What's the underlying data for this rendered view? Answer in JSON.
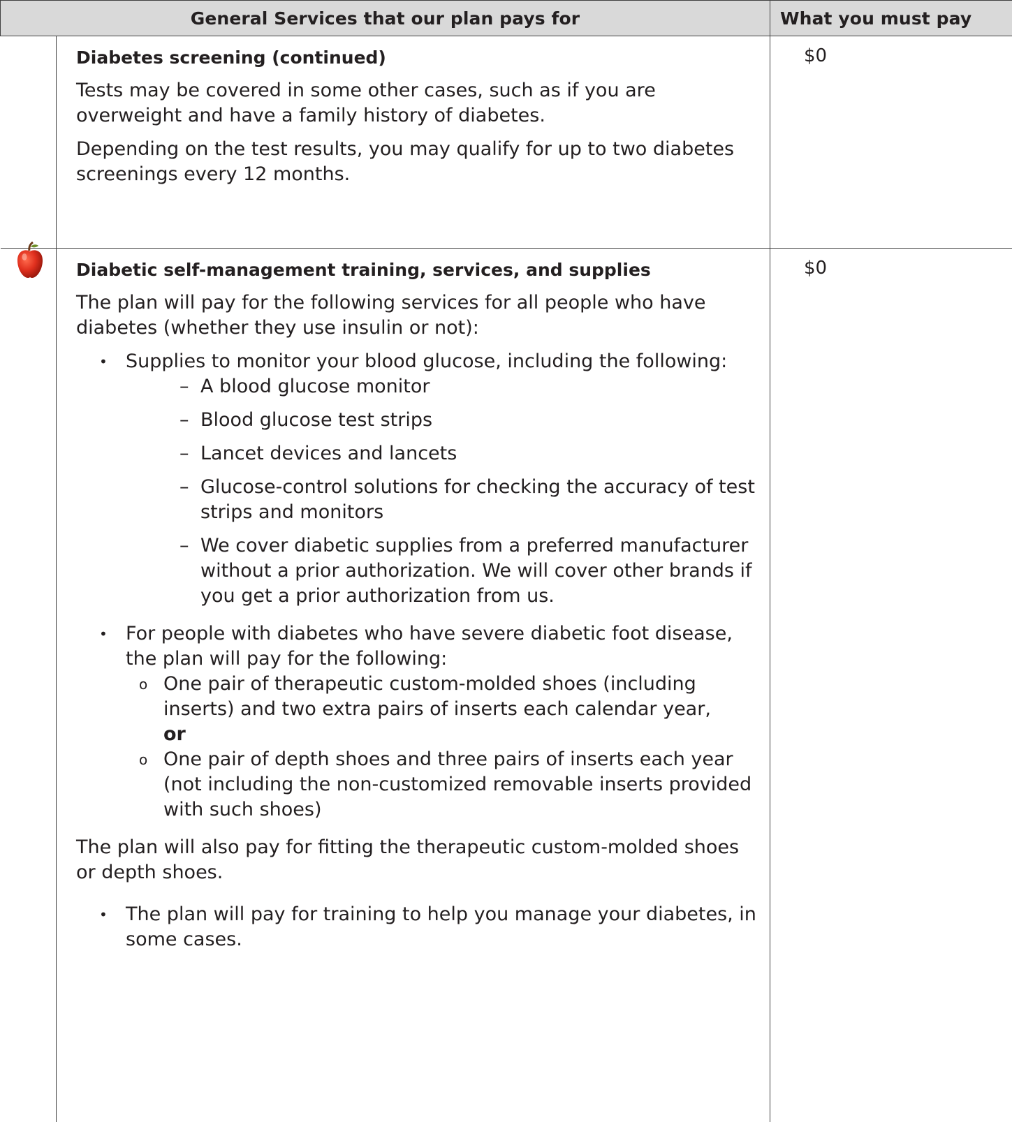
{
  "header": {
    "services_label": "General Services that our plan pays for",
    "pay_label": "What you must pay"
  },
  "row1": {
    "title": "Diabetes screening (continued)",
    "para1": "Tests may be covered in some other cases, such as if you are overweight and have a family history of diabetes.",
    "para2": "Depending on the test results, you may qualify for up to two diabetes screenings every 12 months.",
    "cost": "$0"
  },
  "row2": {
    "icon": "apple-icon",
    "title": "Diabetic self-management training, services, and supplies",
    "intro": "The plan will pay for the following services for all people who have diabetes (whether they use insulin or not):",
    "bullet1": "Supplies to monitor your blood glucose, including the following:",
    "sub_items": [
      "A blood glucose monitor",
      "Blood glucose test strips",
      "Lancet devices and lancets",
      "Glucose-control solutions for checking the accuracy of test strips and monitors",
      "We cover diabetic supplies from a preferred manufacturer without a prior authorization. We will cover other brands if you get a prior authorization from us."
    ],
    "bullet2": "For people with diabetes who have severe diabetic foot disease, the plan will pay for the following:",
    "shoe_option1": "One pair of therapeutic custom-molded shoes (including inserts) and two extra pairs of inserts each calendar year,",
    "or_word": "or",
    "shoe_option2": "One pair of depth shoes and three pairs of inserts each year (not including the non-customized removable inserts provided with such shoes)",
    "fitting_para": "The plan will also pay for fitting the therapeutic custom-molded shoes or depth shoes.",
    "bullet3": "The plan will pay for training to help you manage your diabetes, in some cases.",
    "cost": "$0"
  }
}
